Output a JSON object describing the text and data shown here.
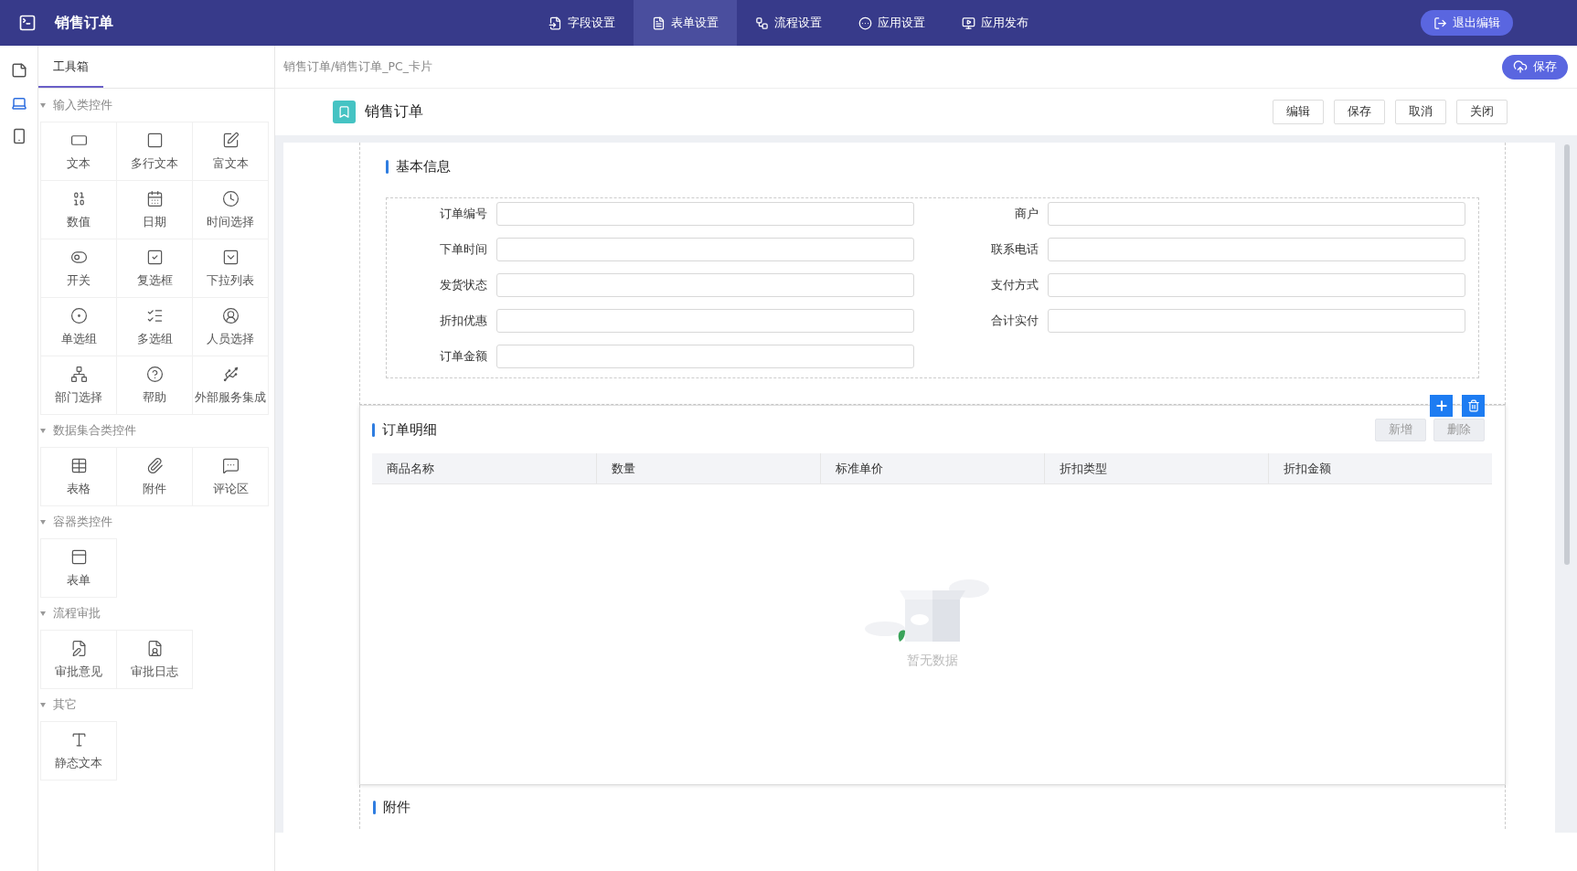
{
  "app_bar": {
    "title": "销售订单",
    "tabs": [
      {
        "label": "字段设置",
        "selected": false
      },
      {
        "label": "表单设置",
        "selected": true
      },
      {
        "label": "流程设置",
        "selected": false
      },
      {
        "label": "应用设置",
        "selected": false
      },
      {
        "label": "应用发布",
        "selected": false
      }
    ],
    "exit_button": "退出编辑"
  },
  "device_rail": [
    {
      "selected": false
    },
    {
      "selected": true
    },
    {
      "selected": false
    }
  ],
  "toolbox": {
    "tab": "工具箱",
    "groups": [
      {
        "title": "输入类控件",
        "expanded": true,
        "items": [
          "文本",
          "多行文本",
          "富文本",
          "数值",
          "日期",
          "时间选择",
          "开关",
          "复选框",
          "下拉列表",
          "单选组",
          "多选组",
          "人员选择",
          "部门选择",
          "帮助",
          "外部服务集成"
        ]
      },
      {
        "title": "数据集合类控件",
        "expanded": true,
        "items": [
          "表格",
          "附件",
          "评论区"
        ]
      },
      {
        "title": "容器类控件",
        "expanded": true,
        "items": [
          "表单"
        ]
      },
      {
        "title": "流程审批",
        "expanded": true,
        "items": [
          "审批意见",
          "审批日志"
        ]
      },
      {
        "title": "其它",
        "expanded": true,
        "items": [
          "静态文本"
        ]
      }
    ]
  },
  "breadcrumb": "销售订单/销售订单_PC_卡片",
  "save_button": "保存",
  "form_header": {
    "title": "销售订单",
    "buttons": [
      "编辑",
      "保存",
      "取消",
      "关闭"
    ]
  },
  "sections": [
    {
      "kind": "fields",
      "title": "基本信息",
      "fields": [
        {
          "label": "订单编号"
        },
        {
          "label": "商户"
        },
        {
          "label": "下单时间"
        },
        {
          "label": "联系电话"
        },
        {
          "label": "发货状态"
        },
        {
          "label": "支付方式"
        },
        {
          "label": "折扣优惠"
        },
        {
          "label": "合计实付"
        },
        {
          "label": "订单金额"
        }
      ]
    },
    {
      "kind": "table",
      "title": "订单明细",
      "buttons": [
        "新增",
        "删除"
      ],
      "columns": [
        "商品名称",
        "数量",
        "标准单价",
        "折扣类型",
        "折扣金额"
      ],
      "empty_text": "暂无数据"
    },
    {
      "kind": "attachments",
      "title": "附件"
    }
  ]
}
